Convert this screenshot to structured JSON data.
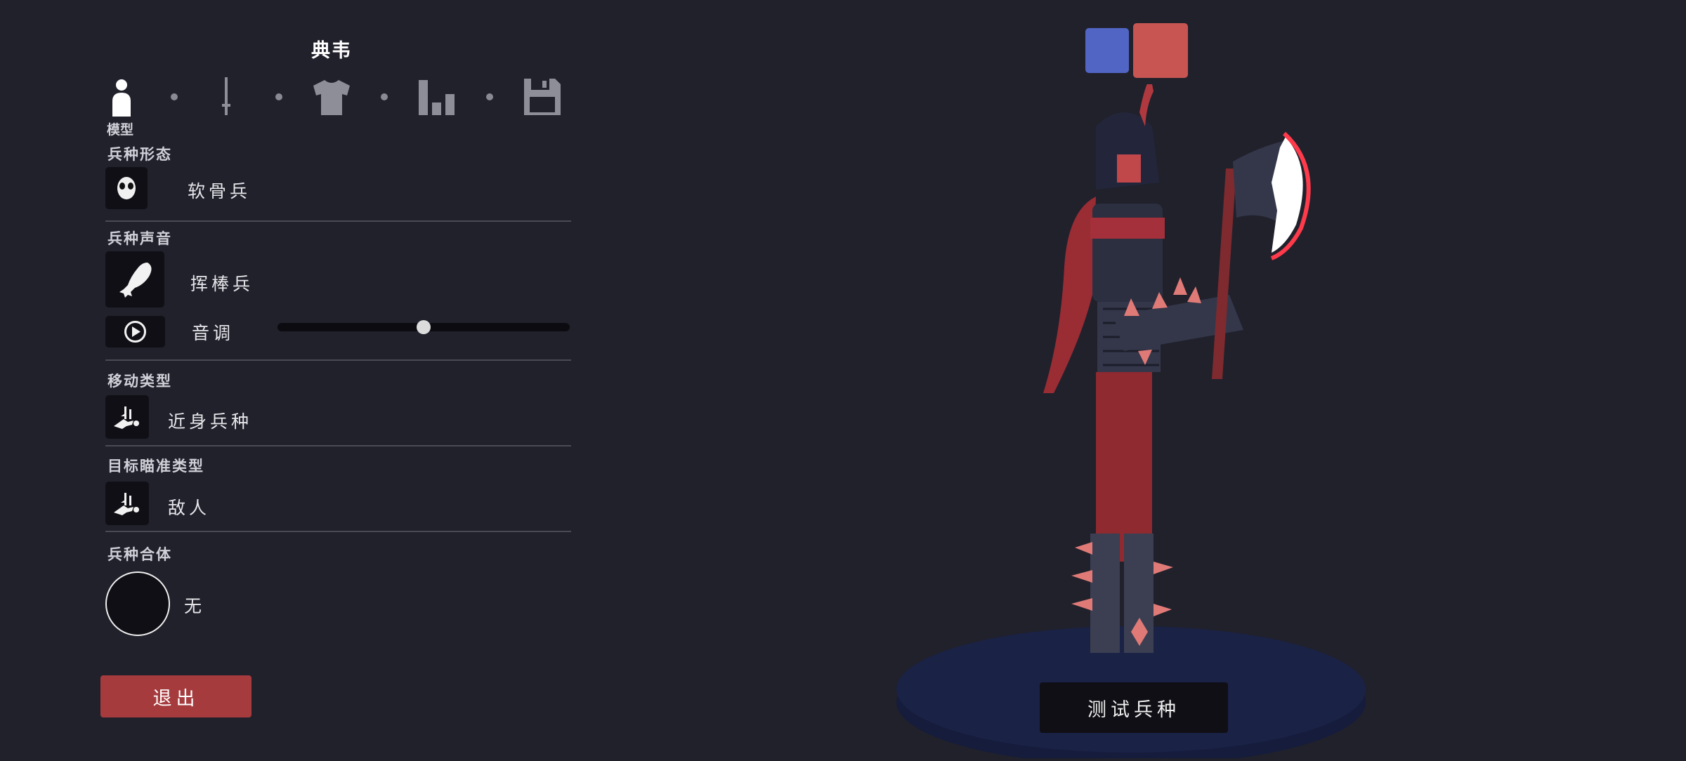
{
  "unit_name": "典韦",
  "tabs": [
    {
      "icon": "person-icon",
      "label": "模型",
      "active": true
    },
    {
      "icon": "sword-icon"
    },
    {
      "icon": "shirt-icon"
    },
    {
      "icon": "bar-chart-icon"
    },
    {
      "icon": "save-icon"
    }
  ],
  "sections": {
    "unit_form": {
      "label": "兵种形态",
      "value": "软骨兵",
      "icon": "mask-face-icon"
    },
    "unit_voice": {
      "label": "兵种声音",
      "value": "挥棒兵",
      "icon": "chicken-leg-icon",
      "pitch_label": "音调",
      "pitch_level": 0.5,
      "play_icon": "play-icon"
    },
    "movement_type": {
      "label": "移动类型",
      "value": "近身兵种",
      "icon": "melee-runner-icon"
    },
    "target_type": {
      "label": "目标瞄准类型",
      "value": "敌人",
      "icon": "target-enemy-icon"
    },
    "unit_merge": {
      "label": "兵种合体",
      "value": "无"
    }
  },
  "buttons": {
    "exit": "退出",
    "test_unit": "测试兵种"
  },
  "team_colors": {
    "blue": "#5165c4",
    "red": "#c95553"
  }
}
